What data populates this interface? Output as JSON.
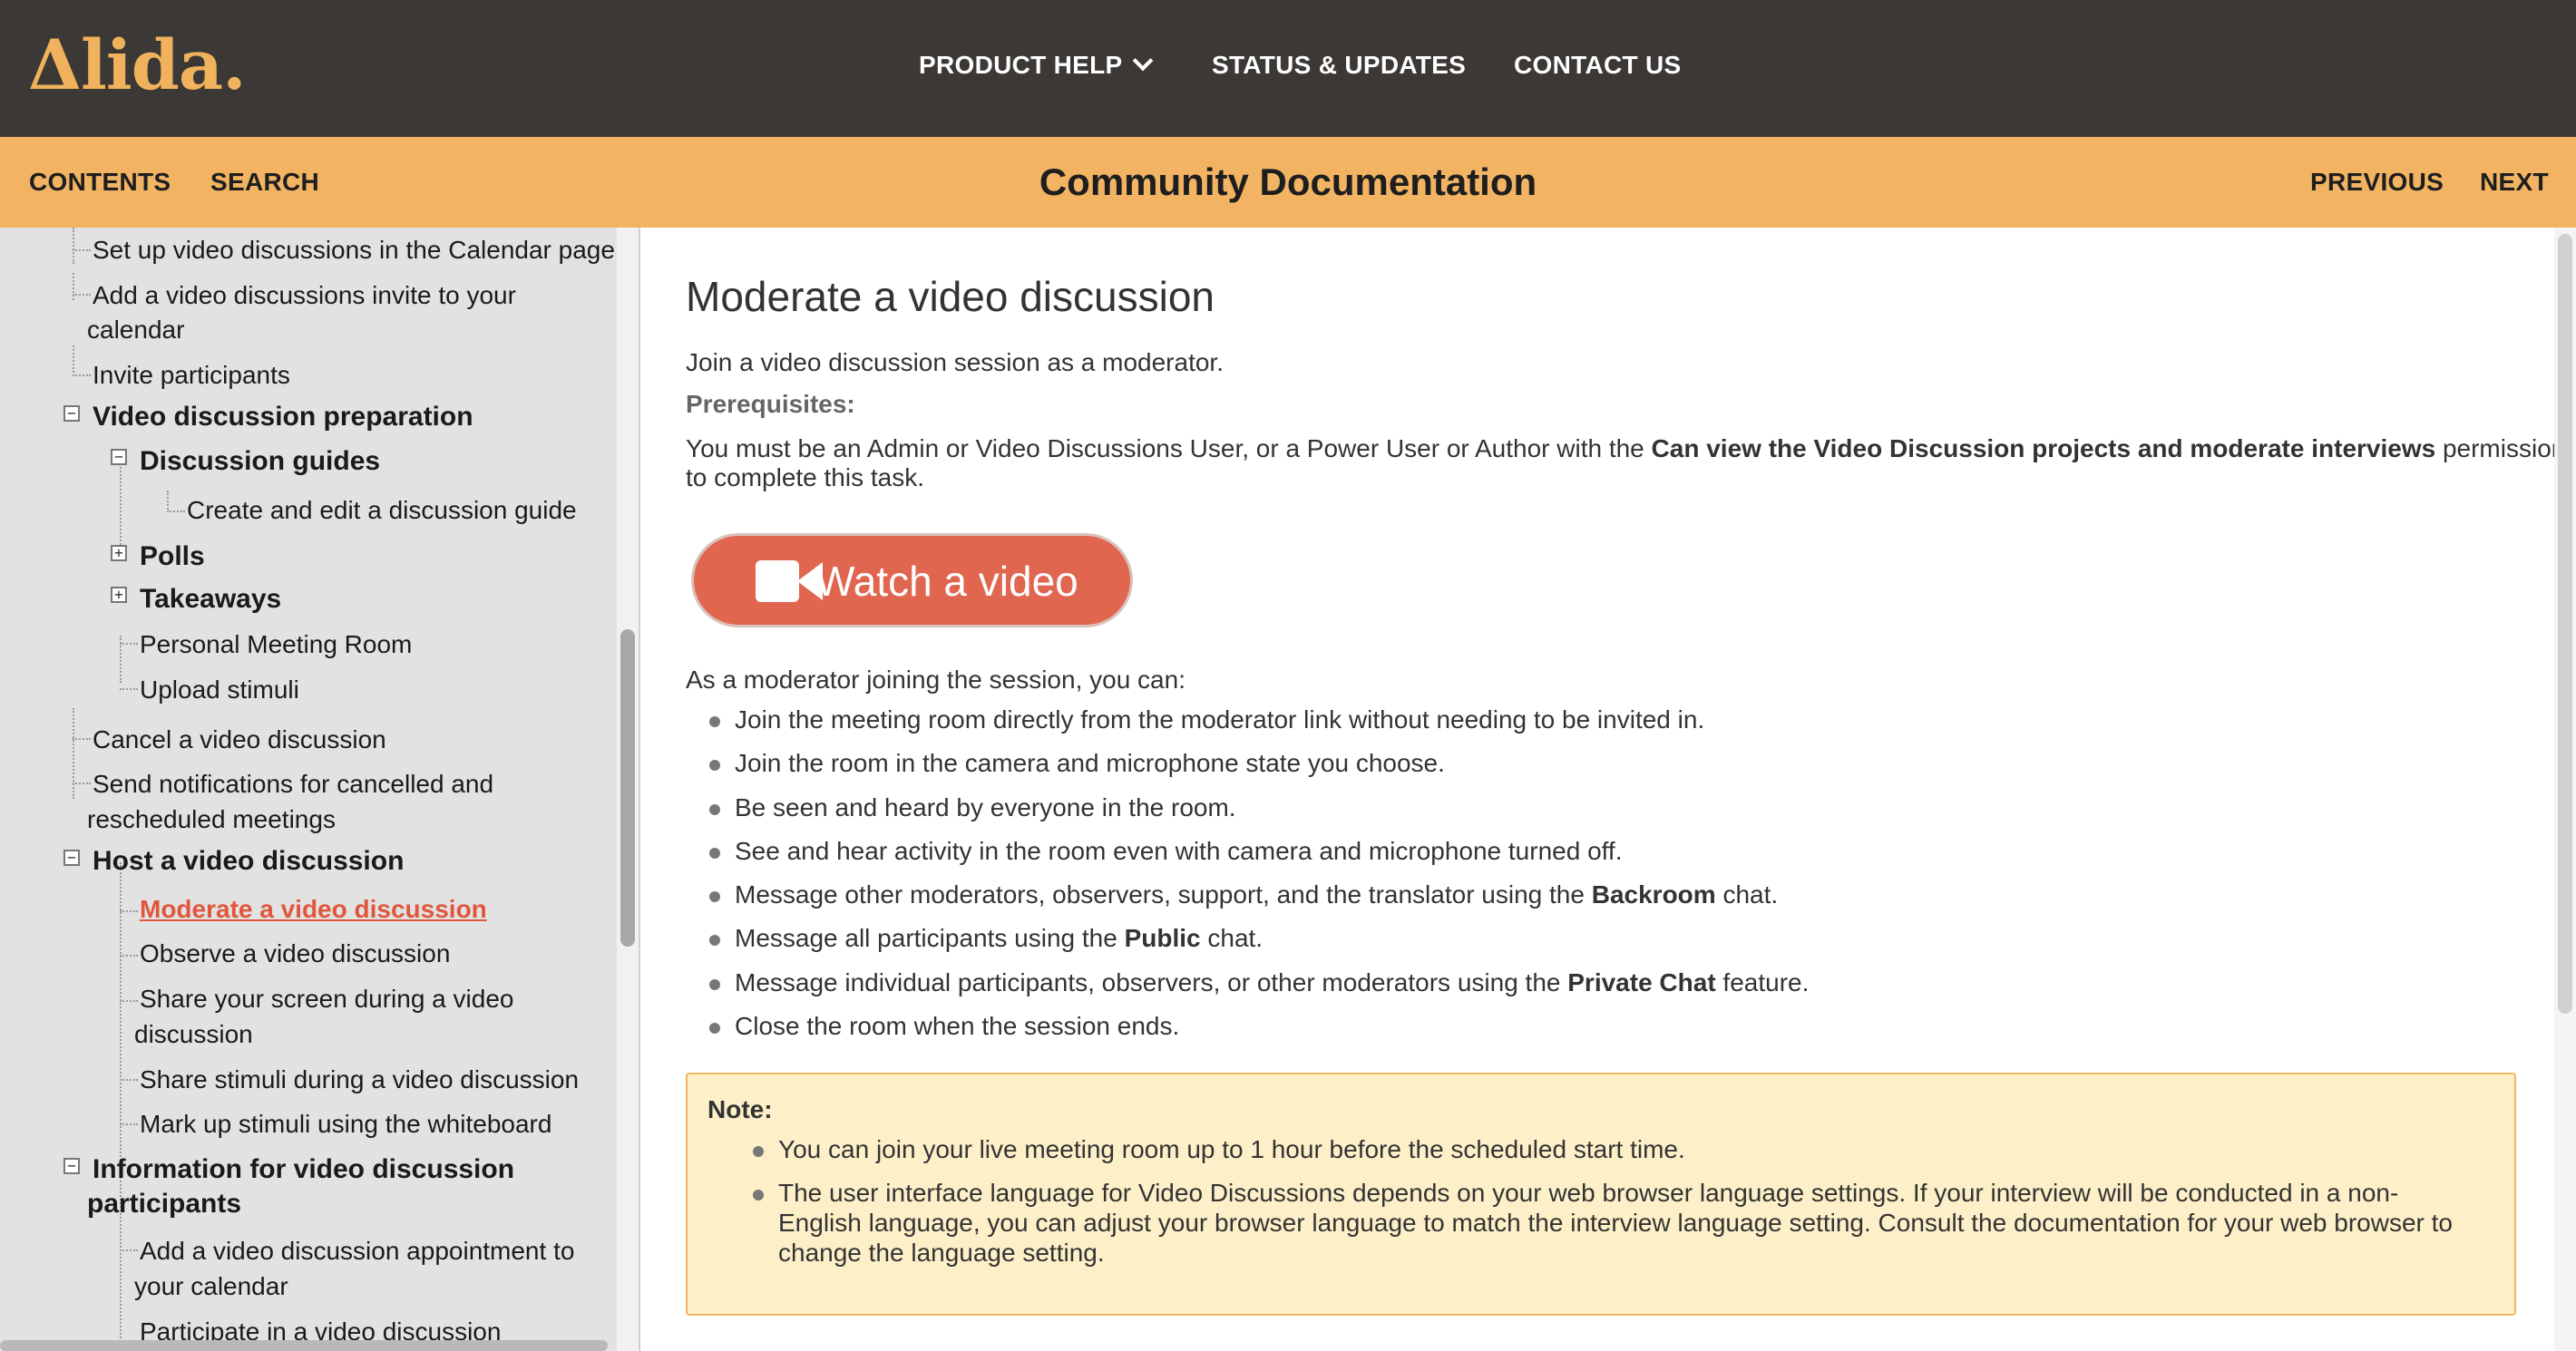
{
  "header": {
    "logo": "Δlida.",
    "nav": {
      "product_help": "PRODUCT HELP",
      "status_updates": "STATUS & UPDATES",
      "contact_us": "CONTACT US"
    }
  },
  "subheader": {
    "contents": "CONTENTS",
    "search": "SEARCH",
    "title": "Community Documentation",
    "previous": "PREVIOUS",
    "next": "NEXT"
  },
  "sidebar": {
    "items": [
      "Set up video discussions in the Calendar page",
      "Add a video discussions invite to your",
      "calendar",
      "Invite participants",
      "Video discussion preparation",
      "Discussion guides",
      "Create and edit a discussion guide",
      "Polls",
      "Takeaways",
      "Personal Meeting Room",
      "Upload stimuli",
      "Cancel a video discussion",
      "Send notifications for cancelled and",
      "rescheduled meetings",
      "Host a video discussion",
      "Moderate a video discussion",
      "Observe a video discussion",
      "Share your screen during a video",
      "discussion",
      "Share stimuli during a video discussion",
      "Mark up stimuli using the whiteboard",
      "Information for video discussion",
      "participants",
      "Add a video discussion appointment to",
      "your calendar",
      "Participate in a video discussion"
    ]
  },
  "main": {
    "title": "Moderate a video discussion",
    "intro": "Join a video discussion session as a moderator.",
    "prereq_label": "Prerequisites:",
    "prereq_text_1": "You must be an Admin or Video Discussions User, or a Power User or Author with the ",
    "prereq_bold": "Can view the Video Discussion projects and moderate interviews",
    "prereq_text_2": " permission",
    "prereq_text_3": "to complete this task.",
    "watch_label": "Watch a video",
    "lead": "As a moderator joining the session, you can:",
    "bullets": {
      "b1": "Join the meeting room directly from the moderator link without needing to be invited in.",
      "b2": "Join the room in the camera and microphone state you choose.",
      "b3": "Be seen and heard by everyone in the room.",
      "b4": "See and hear activity in the room even with camera and microphone turned off.",
      "b5_a": "Message other moderators, observers, support, and the translator using the ",
      "b5_bold": "Backroom",
      "b5_b": " chat.",
      "b6_a": "Message all participants using the ",
      "b6_bold": "Public",
      "b6_b": " chat.",
      "b7_a": "Message individual participants, observers, or other moderators using the ",
      "b7_bold": "Private Chat",
      "b7_b": " feature.",
      "b8": "Close the room when the session ends."
    },
    "note": {
      "title": "Note:",
      "n1": "You can join your live meeting room up to 1 hour before the scheduled start time.",
      "n2_l1": "The user interface language for Video Discussions depends on your web browser language settings. If your interview will be conducted in a non-",
      "n2_l2": "English language, you can adjust your browser language to match the interview language setting. Consult the documentation for your web browser to",
      "n2_l3": "change the language setting."
    }
  },
  "colors": {
    "topbar": "#3c3835",
    "logo": "#f0b25c",
    "orange": "#f2b463",
    "active_link": "#e0573c",
    "watch_button": "#e06650",
    "note_bg": "#fdf0c8"
  },
  "icons": [
    "chevron-down-icon",
    "video-camera-icon",
    "collapse-icon",
    "expand-icon"
  ]
}
